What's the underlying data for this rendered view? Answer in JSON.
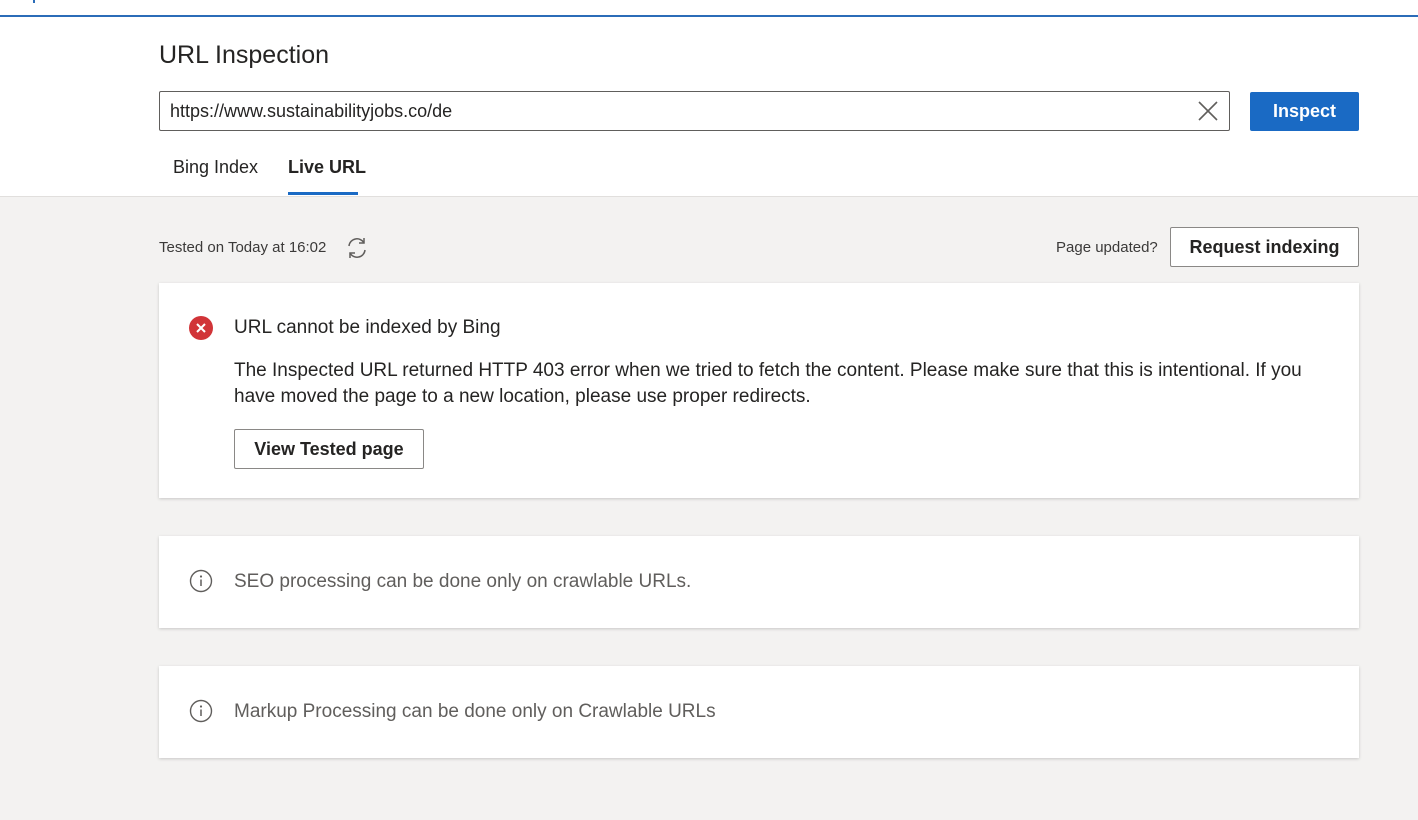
{
  "header": {
    "title": "URL Inspection",
    "url_value": "https://www.sustainabilityjobs.co/de",
    "inspect_label": "Inspect",
    "tabs": [
      {
        "label": "Bing Index",
        "active": false
      },
      {
        "label": "Live URL",
        "active": true
      }
    ]
  },
  "status_bar": {
    "tested_text": "Tested on Today at 16:02",
    "page_updated_text": "Page updated?",
    "request_indexing_label": "Request indexing"
  },
  "error_card": {
    "title": "URL cannot be indexed by Bing",
    "description": "The Inspected URL returned HTTP 403 error when we tried to fetch the content. Please make sure that this is intentional. If you have moved the page to a new location, please use proper redirects.",
    "view_button_label": "View Tested page",
    "icon": "error-circle-icon",
    "color": "#d13438"
  },
  "info_cards": [
    {
      "text": "SEO processing can be done only on crawlable URLs.",
      "icon": "info-icon"
    },
    {
      "text": "Markup Processing can be done only on Crawlable URLs",
      "icon": "info-icon"
    }
  ],
  "colors": {
    "accent": "#1a6ac4",
    "background": "#f3f2f1"
  }
}
